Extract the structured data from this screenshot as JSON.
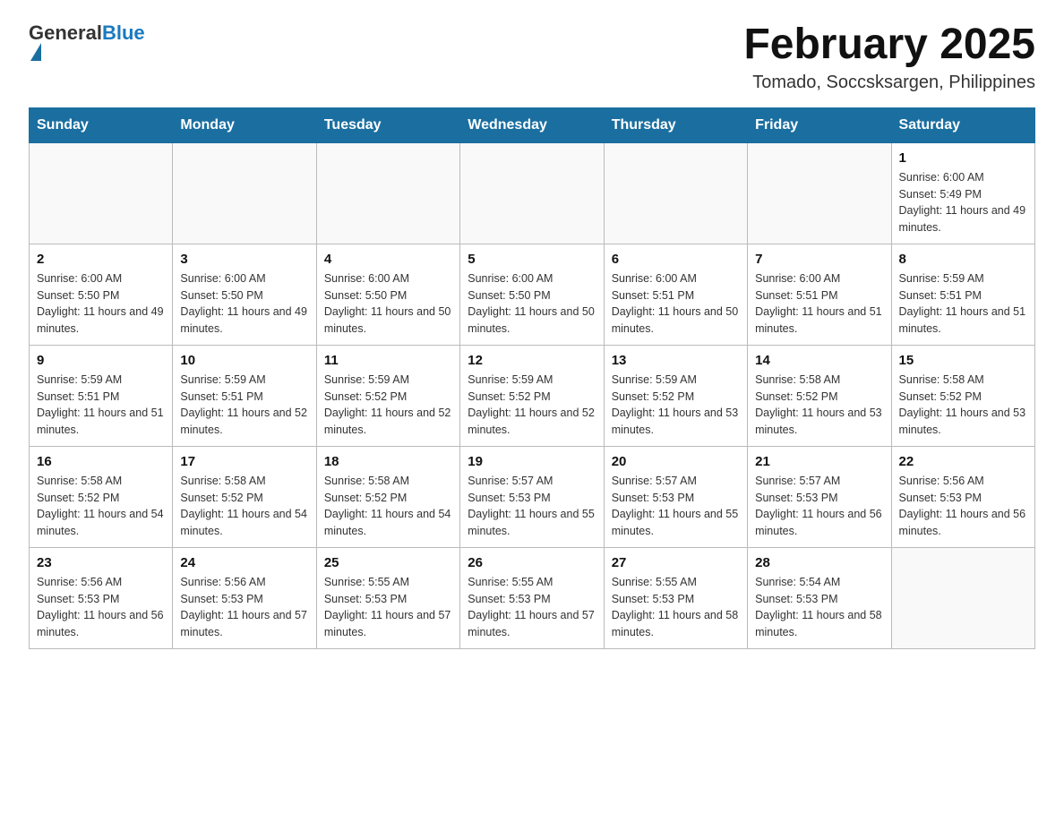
{
  "header": {
    "logo_general": "General",
    "logo_blue": "Blue",
    "title": "February 2025",
    "subtitle": "Tomado, Soccsksargen, Philippines"
  },
  "days_of_week": [
    "Sunday",
    "Monday",
    "Tuesday",
    "Wednesday",
    "Thursday",
    "Friday",
    "Saturday"
  ],
  "weeks": [
    [
      {
        "day": "",
        "sunrise": "",
        "sunset": "",
        "daylight": "",
        "empty": true
      },
      {
        "day": "",
        "sunrise": "",
        "sunset": "",
        "daylight": "",
        "empty": true
      },
      {
        "day": "",
        "sunrise": "",
        "sunset": "",
        "daylight": "",
        "empty": true
      },
      {
        "day": "",
        "sunrise": "",
        "sunset": "",
        "daylight": "",
        "empty": true
      },
      {
        "day": "",
        "sunrise": "",
        "sunset": "",
        "daylight": "",
        "empty": true
      },
      {
        "day": "",
        "sunrise": "",
        "sunset": "",
        "daylight": "",
        "empty": true
      },
      {
        "day": "1",
        "sunrise": "Sunrise: 6:00 AM",
        "sunset": "Sunset: 5:49 PM",
        "daylight": "Daylight: 11 hours and 49 minutes.",
        "empty": false
      }
    ],
    [
      {
        "day": "2",
        "sunrise": "Sunrise: 6:00 AM",
        "sunset": "Sunset: 5:50 PM",
        "daylight": "Daylight: 11 hours and 49 minutes.",
        "empty": false
      },
      {
        "day": "3",
        "sunrise": "Sunrise: 6:00 AM",
        "sunset": "Sunset: 5:50 PM",
        "daylight": "Daylight: 11 hours and 49 minutes.",
        "empty": false
      },
      {
        "day": "4",
        "sunrise": "Sunrise: 6:00 AM",
        "sunset": "Sunset: 5:50 PM",
        "daylight": "Daylight: 11 hours and 50 minutes.",
        "empty": false
      },
      {
        "day": "5",
        "sunrise": "Sunrise: 6:00 AM",
        "sunset": "Sunset: 5:50 PM",
        "daylight": "Daylight: 11 hours and 50 minutes.",
        "empty": false
      },
      {
        "day": "6",
        "sunrise": "Sunrise: 6:00 AM",
        "sunset": "Sunset: 5:51 PM",
        "daylight": "Daylight: 11 hours and 50 minutes.",
        "empty": false
      },
      {
        "day": "7",
        "sunrise": "Sunrise: 6:00 AM",
        "sunset": "Sunset: 5:51 PM",
        "daylight": "Daylight: 11 hours and 51 minutes.",
        "empty": false
      },
      {
        "day": "8",
        "sunrise": "Sunrise: 5:59 AM",
        "sunset": "Sunset: 5:51 PM",
        "daylight": "Daylight: 11 hours and 51 minutes.",
        "empty": false
      }
    ],
    [
      {
        "day": "9",
        "sunrise": "Sunrise: 5:59 AM",
        "sunset": "Sunset: 5:51 PM",
        "daylight": "Daylight: 11 hours and 51 minutes.",
        "empty": false
      },
      {
        "day": "10",
        "sunrise": "Sunrise: 5:59 AM",
        "sunset": "Sunset: 5:51 PM",
        "daylight": "Daylight: 11 hours and 52 minutes.",
        "empty": false
      },
      {
        "day": "11",
        "sunrise": "Sunrise: 5:59 AM",
        "sunset": "Sunset: 5:52 PM",
        "daylight": "Daylight: 11 hours and 52 minutes.",
        "empty": false
      },
      {
        "day": "12",
        "sunrise": "Sunrise: 5:59 AM",
        "sunset": "Sunset: 5:52 PM",
        "daylight": "Daylight: 11 hours and 52 minutes.",
        "empty": false
      },
      {
        "day": "13",
        "sunrise": "Sunrise: 5:59 AM",
        "sunset": "Sunset: 5:52 PM",
        "daylight": "Daylight: 11 hours and 53 minutes.",
        "empty": false
      },
      {
        "day": "14",
        "sunrise": "Sunrise: 5:58 AM",
        "sunset": "Sunset: 5:52 PM",
        "daylight": "Daylight: 11 hours and 53 minutes.",
        "empty": false
      },
      {
        "day": "15",
        "sunrise": "Sunrise: 5:58 AM",
        "sunset": "Sunset: 5:52 PM",
        "daylight": "Daylight: 11 hours and 53 minutes.",
        "empty": false
      }
    ],
    [
      {
        "day": "16",
        "sunrise": "Sunrise: 5:58 AM",
        "sunset": "Sunset: 5:52 PM",
        "daylight": "Daylight: 11 hours and 54 minutes.",
        "empty": false
      },
      {
        "day": "17",
        "sunrise": "Sunrise: 5:58 AM",
        "sunset": "Sunset: 5:52 PM",
        "daylight": "Daylight: 11 hours and 54 minutes.",
        "empty": false
      },
      {
        "day": "18",
        "sunrise": "Sunrise: 5:58 AM",
        "sunset": "Sunset: 5:52 PM",
        "daylight": "Daylight: 11 hours and 54 minutes.",
        "empty": false
      },
      {
        "day": "19",
        "sunrise": "Sunrise: 5:57 AM",
        "sunset": "Sunset: 5:53 PM",
        "daylight": "Daylight: 11 hours and 55 minutes.",
        "empty": false
      },
      {
        "day": "20",
        "sunrise": "Sunrise: 5:57 AM",
        "sunset": "Sunset: 5:53 PM",
        "daylight": "Daylight: 11 hours and 55 minutes.",
        "empty": false
      },
      {
        "day": "21",
        "sunrise": "Sunrise: 5:57 AM",
        "sunset": "Sunset: 5:53 PM",
        "daylight": "Daylight: 11 hours and 56 minutes.",
        "empty": false
      },
      {
        "day": "22",
        "sunrise": "Sunrise: 5:56 AM",
        "sunset": "Sunset: 5:53 PM",
        "daylight": "Daylight: 11 hours and 56 minutes.",
        "empty": false
      }
    ],
    [
      {
        "day": "23",
        "sunrise": "Sunrise: 5:56 AM",
        "sunset": "Sunset: 5:53 PM",
        "daylight": "Daylight: 11 hours and 56 minutes.",
        "empty": false
      },
      {
        "day": "24",
        "sunrise": "Sunrise: 5:56 AM",
        "sunset": "Sunset: 5:53 PM",
        "daylight": "Daylight: 11 hours and 57 minutes.",
        "empty": false
      },
      {
        "day": "25",
        "sunrise": "Sunrise: 5:55 AM",
        "sunset": "Sunset: 5:53 PM",
        "daylight": "Daylight: 11 hours and 57 minutes.",
        "empty": false
      },
      {
        "day": "26",
        "sunrise": "Sunrise: 5:55 AM",
        "sunset": "Sunset: 5:53 PM",
        "daylight": "Daylight: 11 hours and 57 minutes.",
        "empty": false
      },
      {
        "day": "27",
        "sunrise": "Sunrise: 5:55 AM",
        "sunset": "Sunset: 5:53 PM",
        "daylight": "Daylight: 11 hours and 58 minutes.",
        "empty": false
      },
      {
        "day": "28",
        "sunrise": "Sunrise: 5:54 AM",
        "sunset": "Sunset: 5:53 PM",
        "daylight": "Daylight: 11 hours and 58 minutes.",
        "empty": false
      },
      {
        "day": "",
        "sunrise": "",
        "sunset": "",
        "daylight": "",
        "empty": true
      }
    ]
  ]
}
